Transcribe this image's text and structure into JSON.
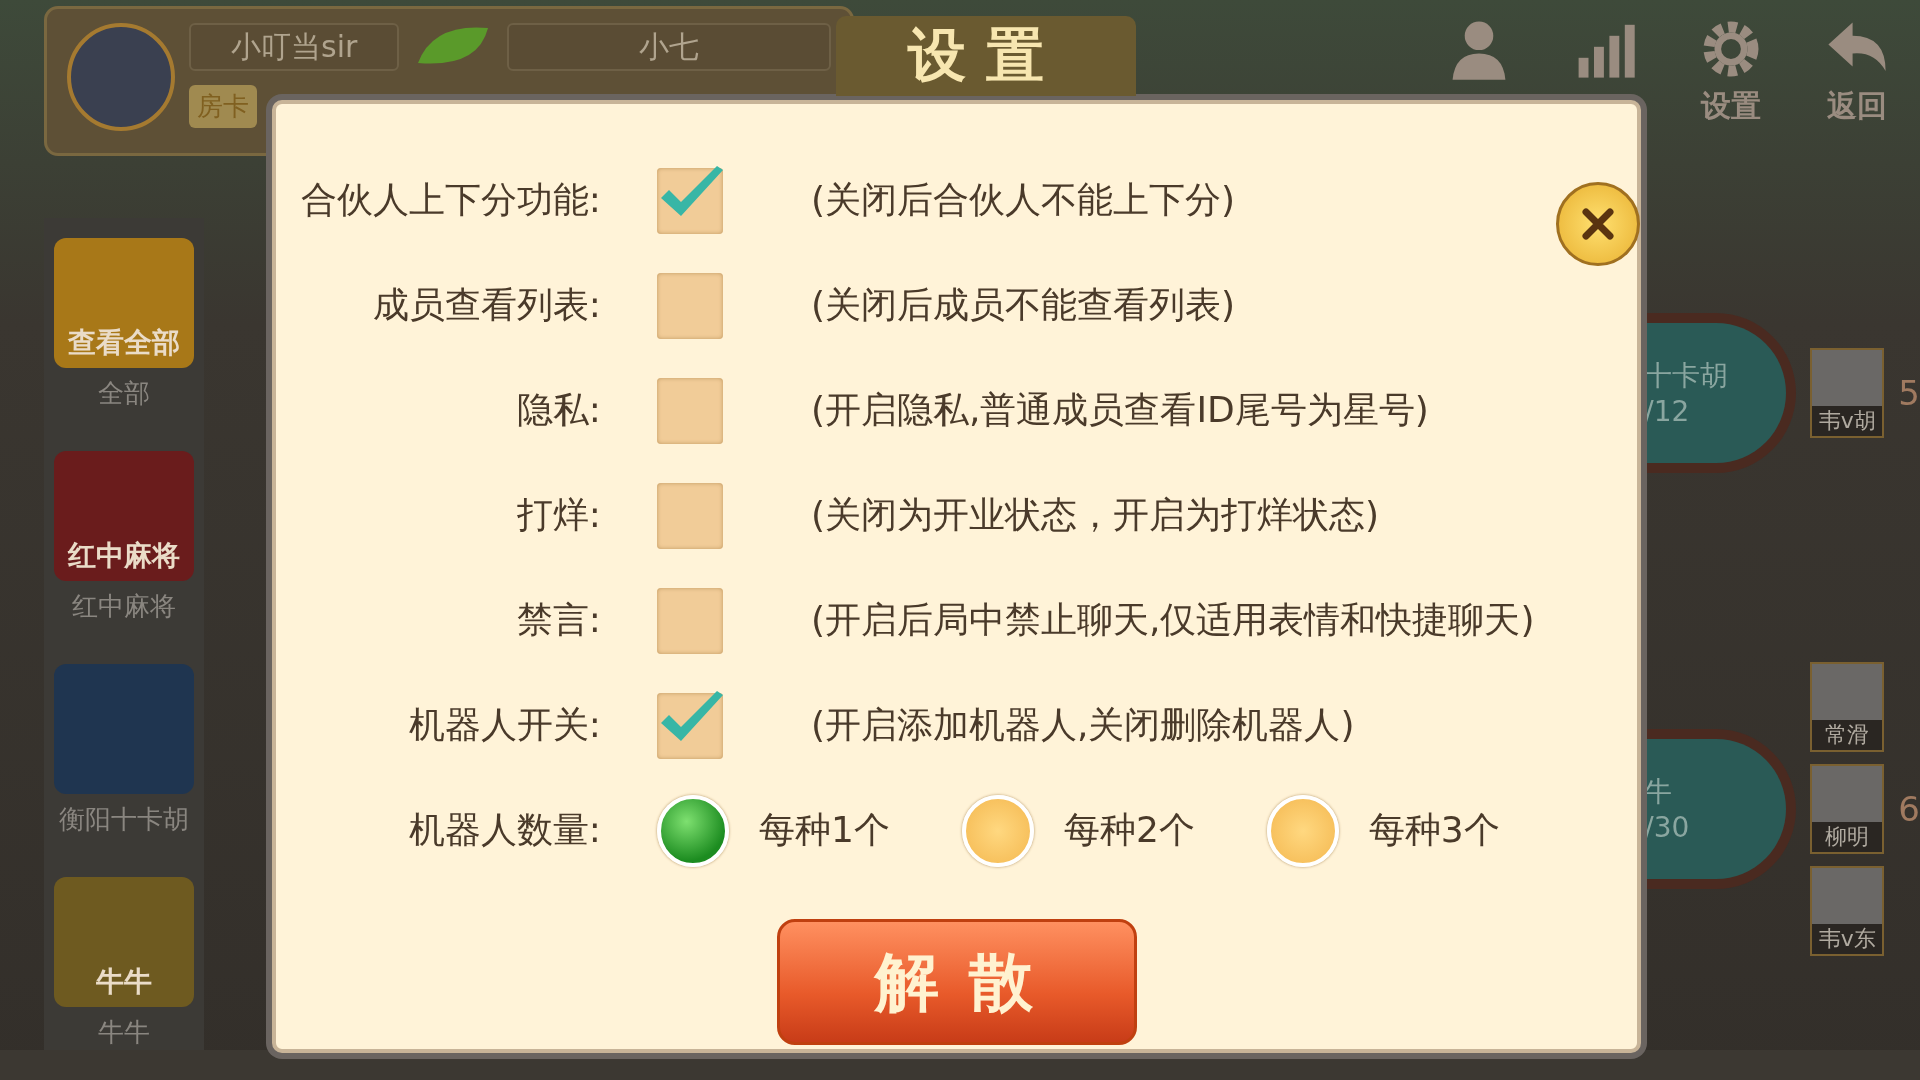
{
  "header": {
    "player_name": "小叮当sir",
    "partner_name": "小七",
    "room_card_label": "房卡"
  },
  "top_buttons": [
    {
      "kind": "person"
    },
    {
      "kind": "chart"
    },
    {
      "kind": "gear",
      "label": "设置"
    },
    {
      "kind": "back",
      "label": "返回"
    }
  ],
  "games": [
    {
      "tile_text": "查看全部",
      "label": "全部",
      "color": "#a87818"
    },
    {
      "tile_text": "红中麻将",
      "label": "红中麻将",
      "color": "#6a1c1c"
    },
    {
      "label": "衡阳十卡胡",
      "color": "#1f3550"
    },
    {
      "tile_text": "牛牛",
      "label": "牛牛",
      "color": "#6e5a20"
    }
  ],
  "tables": [
    {
      "name": "十卡胡",
      "count": "/12",
      "number": "5",
      "players": [
        "韦v胡"
      ]
    },
    {
      "name": "牛",
      "count": "/30",
      "number": "6",
      "players": [
        "常滑",
        "柳明",
        "韦v东"
      ]
    }
  ],
  "dialog": {
    "title": "设置",
    "settings": [
      {
        "label": "合伙人上下分功能:",
        "checked": true,
        "hint": "(关闭后合伙人不能上下分)"
      },
      {
        "label": "成员查看列表:",
        "checked": false,
        "hint": "(关闭后成员不能查看列表)"
      },
      {
        "label": "隐私:",
        "checked": false,
        "hint": "(开启隐私,普通成员查看ID尾号为星号)"
      },
      {
        "label": "打烊:",
        "checked": false,
        "hint": "(关闭为开业状态，开启为打烊状态)"
      },
      {
        "label": "禁言:",
        "checked": false,
        "hint": "(开启后局中禁止聊天,仅适用表情和快捷聊天)"
      },
      {
        "label": "机器人开关:",
        "checked": true,
        "hint": "(开启添加机器人,关闭删除机器人)"
      }
    ],
    "robot_count": {
      "label": "机器人数量:",
      "options": [
        {
          "label": "每种1个",
          "selected": true
        },
        {
          "label": "每种2个",
          "selected": false
        },
        {
          "label": "每种3个",
          "selected": false
        }
      ]
    },
    "dismiss_button": "解散"
  }
}
